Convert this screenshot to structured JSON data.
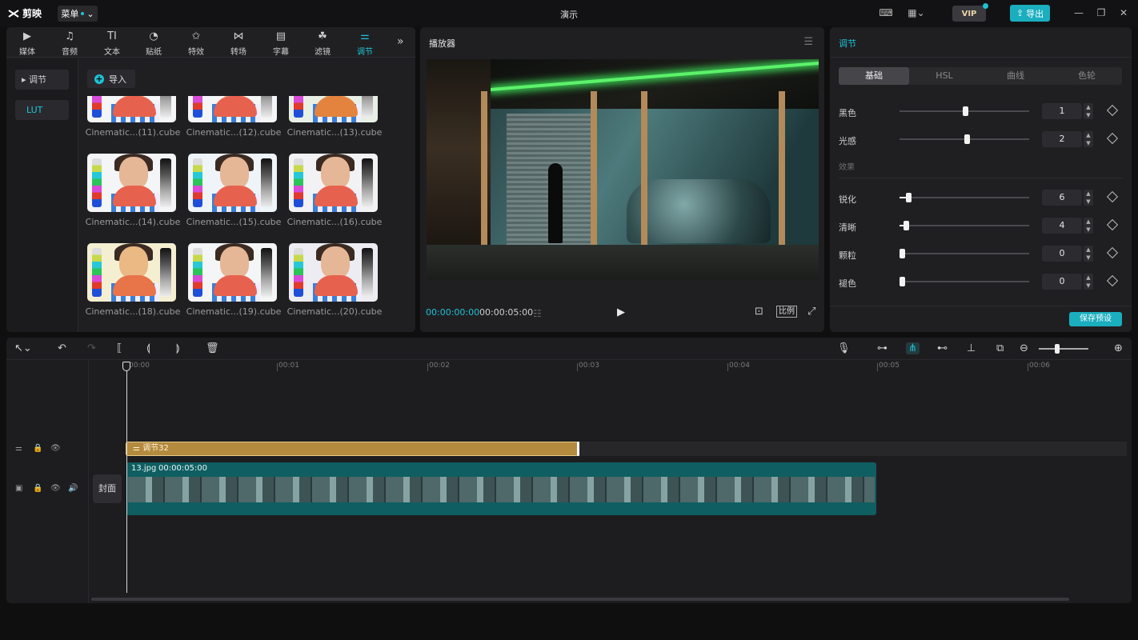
{
  "app": {
    "logo_text": "剪映",
    "menu_label": "菜单",
    "window_title": "演示",
    "vip_label": "VIP",
    "export_label": "导出",
    "accent_color": "#1ec2d6"
  },
  "tool_tabs": [
    {
      "label": "媒体",
      "icon": "media-icon"
    },
    {
      "label": "音频",
      "icon": "audio-icon"
    },
    {
      "label": "文本",
      "icon": "text-icon",
      "glyph": "TI"
    },
    {
      "label": "贴纸",
      "icon": "sticker-icon"
    },
    {
      "label": "特效",
      "icon": "effects-icon"
    },
    {
      "label": "转场",
      "icon": "transition-icon"
    },
    {
      "label": "字幕",
      "icon": "subtitle-icon"
    },
    {
      "label": "滤镜",
      "icon": "filter-icon"
    },
    {
      "label": "调节",
      "icon": "adjust-icon",
      "active": true
    }
  ],
  "side_nav": {
    "items": [
      {
        "label": "调节"
      },
      {
        "label": "LUT",
        "active": true
      }
    ]
  },
  "import_label": "导入",
  "luts": [
    {
      "name": "Cinematic...(11).cube"
    },
    {
      "name": "Cinematic...(12).cube"
    },
    {
      "name": "Cinematic...(13).cube"
    },
    {
      "name": "Cinematic...(14).cube"
    },
    {
      "name": "Cinematic...(15).cube"
    },
    {
      "name": "Cinematic...(16).cube"
    },
    {
      "name": "Cinematic...(18).cube"
    },
    {
      "name": "Cinematic...(19).cube"
    },
    {
      "name": "Cinematic...(20).cube"
    }
  ],
  "player": {
    "title": "播放器",
    "current_time": "00:00:00:00",
    "total_time": "00:00:05:00",
    "ratio_label": "比例"
  },
  "adjust": {
    "title": "调节",
    "tabs": [
      "基础",
      "HSL",
      "曲线",
      "色轮"
    ],
    "active_tab": "基础",
    "rows_top": [
      {
        "label": "黑色",
        "value": "1"
      },
      {
        "label": "光感",
        "value": "2"
      }
    ],
    "section_label": "效果",
    "rows_effect": [
      {
        "label": "锐化",
        "value": "6"
      },
      {
        "label": "清晰",
        "value": "4"
      },
      {
        "label": "颗粒",
        "value": "0"
      },
      {
        "label": "褪色",
        "value": "0"
      }
    ],
    "save_preset_label": "保存预设"
  },
  "timeline": {
    "ruler": [
      "00:00",
      "00:01",
      "00:02",
      "00:03",
      "00:04",
      "00:05",
      "00:06"
    ],
    "adjust_clip_label": "调节32",
    "video_clip_name": "13.jpg",
    "video_clip_duration": "00:00:05:00",
    "cover_label": "封面"
  }
}
